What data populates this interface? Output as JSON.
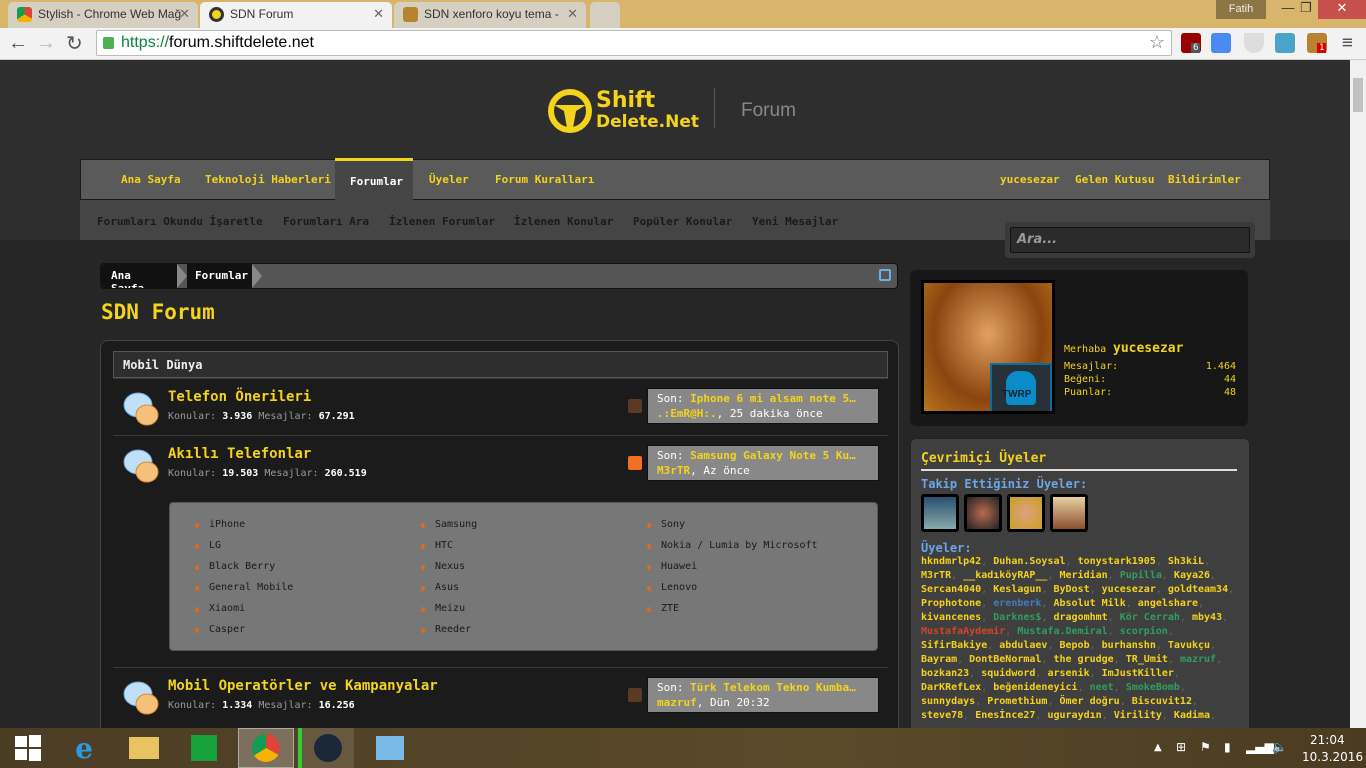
{
  "browser": {
    "tabs": [
      {
        "title": "Stylish - Chrome Web Mağ"
      },
      {
        "title": "SDN Forum"
      },
      {
        "title": "SDN xenforo koyu tema -"
      }
    ],
    "user": "Fatih",
    "url_scheme": "https://",
    "url_host": "forum.shiftdelete.net",
    "ext_badges": {
      "ublock": "6",
      "stylish": "1"
    },
    "colors": {
      "frame": "#d9b46b",
      "accent": "#f3d31c"
    }
  },
  "site": {
    "logo_line1": "Shift",
    "logo_line2": "Delete.Net",
    "logo_forum": "Forum",
    "nav": [
      "Ana Sayfa",
      "Teknoloji Haberleri",
      "Forumlar",
      "Üyeler",
      "Forum Kuralları"
    ],
    "nav_right": [
      "yucesezar",
      "Gelen Kutusu",
      "Bildirimler"
    ],
    "subnav": [
      "Forumları Okundu İşaretle",
      "Forumları Ara",
      "İzlenen Forumlar",
      "İzlenen Konular",
      "Popüler Konular",
      "Yeni Mesajlar"
    ],
    "search_placeholder": "Ara...",
    "breadcrumb": [
      "Ana Sayfa",
      "Forumlar"
    ],
    "page_title": "SDN Forum"
  },
  "category": {
    "title": "Mobil Dünya",
    "forums": [
      {
        "title": "Telefon Önerileri",
        "topics_label": "Konular:",
        "topics": "3.936",
        "msgs_label": "Mesajlar:",
        "msgs": "67.291",
        "last_label": "Son:",
        "last_title": "Iphone 6 mi alsam note 5…",
        "last_user": ".:EmR@H:.",
        "last_time": ", 25 dakika önce"
      },
      {
        "title": "Akıllı Telefonlar",
        "topics_label": "Konular:",
        "topics": "19.503",
        "msgs_label": "Mesajlar:",
        "msgs": "260.519",
        "last_label": "Son:",
        "last_title": "Samsung Galaxy Note 5 Ku…",
        "last_user": "M3rTR",
        "last_time": ", Az önce"
      },
      {
        "title": "Mobil Operatörler ve Kampanyalar",
        "topics_label": "Konular:",
        "topics": "1.334",
        "msgs_label": "Mesajlar:",
        "msgs": "16.256",
        "last_label": "Son:",
        "last_title": "Türk Telekom Tekno Kumba…",
        "last_user": "mazruf",
        "last_time": ", Dün 20:32"
      }
    ],
    "subforums": [
      [
        "iPhone",
        "LG",
        "Black Berry",
        "General Mobile",
        "Xiaomi",
        "Casper"
      ],
      [
        "Samsung",
        "HTC",
        "Nexus",
        "Asus",
        "Meizu",
        "Reeder"
      ],
      [
        "Sony",
        "Nokia / Lumia by Microsoft",
        "Huawei",
        "Lenovo",
        "ZTE"
      ]
    ]
  },
  "visitor": {
    "greeting": "Merhaba",
    "name": "yucesezar",
    "stats": [
      {
        "label": "Mesajlar:",
        "value": "1.464"
      },
      {
        "label": "Beğeni:",
        "value": "44"
      },
      {
        "label": "Puanlar:",
        "value": "48"
      }
    ],
    "badge": "TWRP"
  },
  "online": {
    "title": "Çevrimiçi Üyeler",
    "following_label": "Takip Ettiğiniz Üyeler:",
    "members_label": "Üyeler:",
    "members": [
      {
        "n": "hkndmrlp42",
        "c": "#f3d31c"
      },
      {
        "n": "Duhan.Soysal",
        "c": "#f3d31c"
      },
      {
        "n": "tonystark1905",
        "c": "#f3d31c"
      },
      {
        "n": "Sh3kiL",
        "c": "#f3d31c"
      },
      {
        "n": "M3rTR",
        "c": "#f3d31c"
      },
      {
        "n": "__kadıköyRAP__",
        "c": "#f3d31c"
      },
      {
        "n": "Meridian",
        "c": "#f3d31c"
      },
      {
        "n": "Pupilla",
        "c": "#2f9e5e"
      },
      {
        "n": "Kaya26",
        "c": "#f3d31c"
      },
      {
        "n": "Sercan4040",
        "c": "#f3d31c"
      },
      {
        "n": "Keslagun",
        "c": "#f3d31c"
      },
      {
        "n": "ByDost",
        "c": "#f3d31c"
      },
      {
        "n": "yucesezar",
        "c": "#f3d31c"
      },
      {
        "n": "goldteam34",
        "c": "#f3d31c"
      },
      {
        "n": "Prophotone",
        "c": "#f3d31c"
      },
      {
        "n": "erenberk",
        "c": "#3d7fc4"
      },
      {
        "n": "Absolut Milk",
        "c": "#f3d31c"
      },
      {
        "n": "angelshare",
        "c": "#f3d31c"
      },
      {
        "n": "kivancenes",
        "c": "#f3d31c"
      },
      {
        "n": "Darknes$",
        "c": "#2f9e5e"
      },
      {
        "n": "dragomhmt",
        "c": "#f3d31c"
      },
      {
        "n": "Kör Cerrah",
        "c": "#2f9e5e"
      },
      {
        "n": "mby43",
        "c": "#f3d31c"
      },
      {
        "n": "MustafaAydemir",
        "c": "#d0452a"
      },
      {
        "n": "Mustafa.Demiral",
        "c": "#2f9e5e"
      },
      {
        "n": "scorpion",
        "c": "#2f9e5e"
      },
      {
        "n": "SifirBakiye",
        "c": "#f3d31c"
      },
      {
        "n": "abdulaev",
        "c": "#f3d31c"
      },
      {
        "n": "Bepob",
        "c": "#f3d31c"
      },
      {
        "n": "burhanshn",
        "c": "#f3d31c"
      },
      {
        "n": "Tavukçu",
        "c": "#f3d31c"
      },
      {
        "n": "Bayram",
        "c": "#f3d31c"
      },
      {
        "n": "DontBeNormal",
        "c": "#f3d31c"
      },
      {
        "n": "the grudge",
        "c": "#f3d31c"
      },
      {
        "n": "TR_Umit",
        "c": "#f3d31c"
      },
      {
        "n": "mazruf",
        "c": "#2f9e5e"
      },
      {
        "n": "bozkan23",
        "c": "#f3d31c"
      },
      {
        "n": "squidword",
        "c": "#f3d31c"
      },
      {
        "n": "arsenik",
        "c": "#f3d31c"
      },
      {
        "n": "ImJustKiller",
        "c": "#f3d31c"
      },
      {
        "n": "DarKRefLex",
        "c": "#f3d31c"
      },
      {
        "n": "beğenideneyici",
        "c": "#f3d31c"
      },
      {
        "n": "neet",
        "c": "#2f9e5e"
      },
      {
        "n": "SmokeBomb",
        "c": "#2f9e5e"
      },
      {
        "n": "sunnydays",
        "c": "#f3d31c"
      },
      {
        "n": "Promethium",
        "c": "#f3d31c"
      },
      {
        "n": "Ömer doğru",
        "c": "#f3d31c"
      },
      {
        "n": "Biscuvit12",
        "c": "#f3d31c"
      },
      {
        "n": "steve78",
        "c": "#f3d31c"
      },
      {
        "n": "Enesİnce27",
        "c": "#f3d31c"
      },
      {
        "n": "uguraydın",
        "c": "#f3d31c"
      },
      {
        "n": "Virility",
        "c": "#f3d31c"
      },
      {
        "n": "Kadima",
        "c": "#f3d31c"
      }
    ]
  },
  "taskbar": {
    "time": "21:04",
    "date": "10.3.2016"
  }
}
